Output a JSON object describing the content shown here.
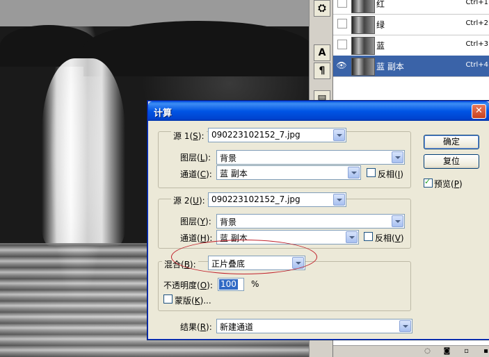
{
  "layers_panel": {
    "layers": [
      {
        "name": "红",
        "shortcut": "Ctrl+1",
        "visible": false,
        "selected": false
      },
      {
        "name": "绿",
        "shortcut": "Ctrl+2",
        "visible": false,
        "selected": false
      },
      {
        "name": "蓝",
        "shortcut": "Ctrl+3",
        "visible": false,
        "selected": false
      },
      {
        "name": "蓝 副本",
        "shortcut": "Ctrl+4",
        "visible": true,
        "selected": true
      }
    ],
    "selected_color": "#3a63a8"
  },
  "tool_strip": {
    "icons": [
      "paint-bucket-icon",
      "text-icon",
      "paragraph-icon",
      "panel-icon"
    ],
    "glyphs": [
      "⛭",
      "A",
      "¶",
      "▤"
    ]
  },
  "dialog": {
    "title": "计算",
    "close_glyph": "✕",
    "source1": {
      "label": "源 1(",
      "hotkey": "S",
      "label_end": "):",
      "file": "090223102152_7.jpg",
      "layer_label": "图层(",
      "layer_hotkey": "L",
      "layer_end": "):",
      "layer_value": "背景",
      "channel_label": "通道(",
      "channel_hotkey": "C",
      "channel_end": "):",
      "channel_value": "蓝 副本",
      "invert_label": "反相(",
      "invert_hotkey": "I",
      "invert_end": ")",
      "invert_checked": false
    },
    "source2": {
      "label": "源 2(",
      "hotkey": "U",
      "label_end": "):",
      "file": "090223102152_7.jpg",
      "layer_label": "图层(",
      "layer_hotkey": "Y",
      "layer_end": "):",
      "layer_value": "背景",
      "channel_label": "通道(",
      "channel_hotkey": "H",
      "channel_end": "):",
      "channel_value": "蓝 副本",
      "invert_label": "反相(",
      "invert_hotkey": "V",
      "invert_end": ")",
      "invert_checked": false
    },
    "blend": {
      "label": "混合(",
      "hotkey": "B",
      "label_end": "):",
      "value": "正片叠底",
      "opacity_label": "不透明度(",
      "opacity_hotkey": "O",
      "opacity_end": "):",
      "opacity_value": "100",
      "opacity_unit": "%",
      "mask_label": "蒙版(",
      "mask_hotkey": "K",
      "mask_end": ")...",
      "mask_checked": false
    },
    "result": {
      "label": "结果(",
      "hotkey": "R",
      "label_end": "):",
      "value": "新建通道"
    },
    "buttons": {
      "ok": "确定",
      "reset": "复位"
    },
    "preview": {
      "label": "预览(",
      "hotkey": "P",
      "label_end": ")",
      "checked": true
    }
  },
  "colors": {
    "titlebar": "#0055e5",
    "annotation": "#c0202a"
  }
}
